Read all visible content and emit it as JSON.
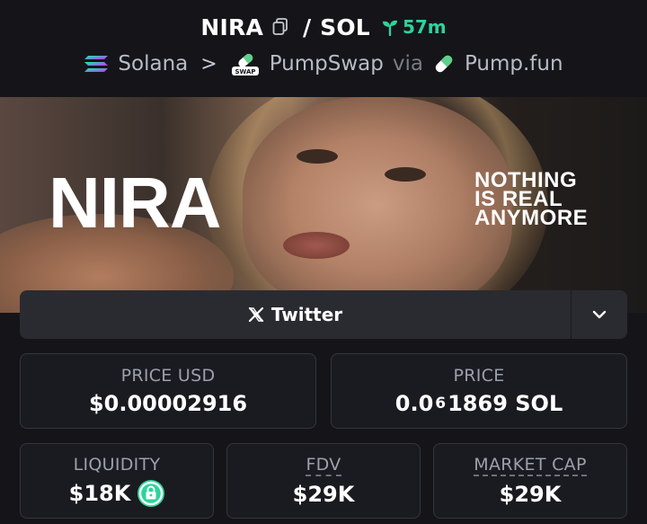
{
  "header": {
    "token_symbol": "NIRA",
    "separator": "/",
    "quote_symbol": "SOL",
    "age": "57m",
    "chain": "Solana",
    "chain_sep": ">",
    "dex": "PumpSwap",
    "via": "via",
    "launchpad": "Pump.fun",
    "dex_badge": "SWAP"
  },
  "banner": {
    "title": "NIRA",
    "tagline": [
      "NOTHING",
      "IS REAL",
      "ANYMORE"
    ]
  },
  "social": {
    "primary_label": "Twitter"
  },
  "stats": {
    "price_usd": {
      "label": "PRICE USD",
      "value": "$0.00002916"
    },
    "price": {
      "label": "PRICE",
      "value_prefix": "0.0",
      "value_sub": "6",
      "value_suffix": "1869 SOL"
    },
    "liquidity": {
      "label": "LIQUIDITY",
      "value": "$18K"
    },
    "fdv": {
      "label": "FDV",
      "value": "$29K"
    },
    "market_cap": {
      "label": "MARKET CAP",
      "value": "$29K"
    }
  },
  "colors": {
    "background": "#151519",
    "accent_green": "#2fd39a",
    "card_border": "#34363d",
    "muted_text": "#9aa0ac"
  },
  "icons": [
    "copy-icon",
    "seedling-icon",
    "solana-icon",
    "pumpswap-icon",
    "pill-icon",
    "x-icon",
    "chevron-down-icon",
    "lock-icon"
  ]
}
